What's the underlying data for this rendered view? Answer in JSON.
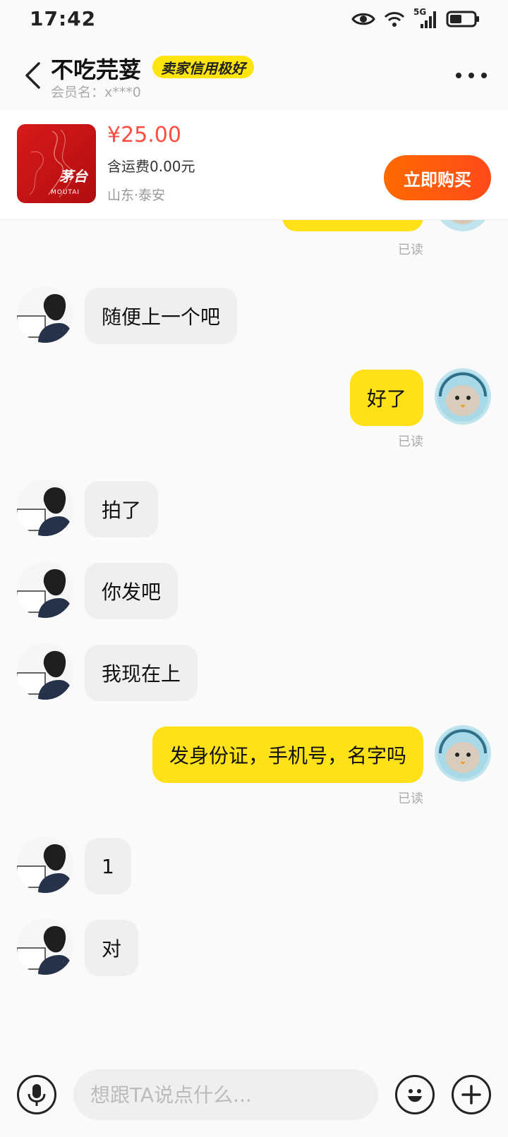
{
  "status_bar": {
    "time": "17:42",
    "network": "5G"
  },
  "header": {
    "seller_name": "不吃芫荽",
    "credit_badge": "卖家信用极好",
    "member_label": "会员名：x***0"
  },
  "product": {
    "brand_text": "茅台",
    "brand_sub": "MOUTAI",
    "price": "¥25.00",
    "shipping": "含运费0.00元",
    "location": "山东·泰安",
    "buy_label": "立即购买"
  },
  "chat": {
    "read_label": "已读",
    "messages": [
      {
        "side": "left",
        "text": "随便上一个吧"
      },
      {
        "side": "right",
        "text": "好了"
      },
      {
        "side": "left",
        "text": "拍了"
      },
      {
        "side": "left",
        "text": "你发吧"
      },
      {
        "side": "left",
        "text": "我现在上"
      },
      {
        "side": "right",
        "text": "发身份证，手机号，名字吗"
      },
      {
        "side": "left",
        "text": "1"
      },
      {
        "side": "left",
        "text": "对"
      }
    ]
  },
  "input": {
    "placeholder": "想跟TA说点什么..."
  },
  "icons": {
    "back": "chevron-left-icon",
    "more": "more-dots-icon",
    "voice": "microphone-icon",
    "emoji": "emoji-icon",
    "plus": "plus-icon"
  },
  "colors": {
    "accent_yellow": "#ffe11a",
    "buy_orange": "#ff5a14",
    "price_red": "#ff4d3f"
  }
}
